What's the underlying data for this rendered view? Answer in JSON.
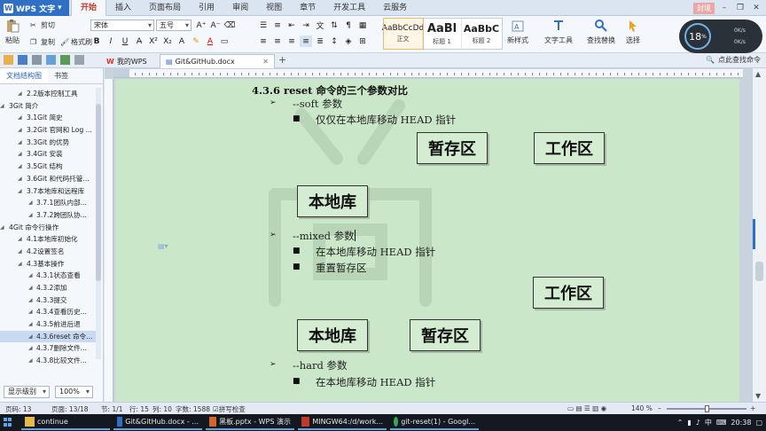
{
  "app": {
    "name": "WPS 文字",
    "ribbon_tabs": [
      "开始",
      "插入",
      "页面布局",
      "引用",
      "审阅",
      "视图",
      "章节",
      "开发工具",
      "云服务"
    ],
    "active_tab": "开始",
    "login": "封境"
  },
  "ribbon": {
    "paste": "粘贴",
    "cut": "剪切",
    "copy": "复制",
    "format_painter": "格式刷",
    "font": "宋体",
    "font_size": "五号",
    "styles": [
      {
        "sample": "AaBbCcDd",
        "label": "正文"
      },
      {
        "sample": "AaBl",
        "label": "标题 1"
      },
      {
        "sample": "AaBbC",
        "label": "标题 2"
      }
    ],
    "new_style": "新样式",
    "text_tools": "文字工具",
    "find_replace": "查找替换",
    "select": "选择"
  },
  "speed_widget": {
    "percent": "18",
    "unit": "%",
    "up": "0K/s",
    "down": "0K/s"
  },
  "quickbar": {
    "tabs": [
      {
        "label": "我的WPS"
      },
      {
        "label": "Git&GitHub.docx"
      }
    ],
    "help": "点此查找命令"
  },
  "nav": {
    "tabs": [
      "文档结构图",
      "书签"
    ],
    "items": [
      {
        "text": "2.2版本控制工具",
        "level": 2,
        "selected": false
      },
      {
        "text": "3Git 简介",
        "level": 1,
        "selected": false
      },
      {
        "text": "3.1Git 简史",
        "level": 2,
        "selected": false
      },
      {
        "text": "3.2Git 官网和 Log ...",
        "level": 2,
        "selected": false
      },
      {
        "text": "3.3Git 的优势",
        "level": 2,
        "selected": false
      },
      {
        "text": "3.4Git 安装",
        "level": 2,
        "selected": false
      },
      {
        "text": "3.5Git 结构",
        "level": 2,
        "selected": false
      },
      {
        "text": "3.6Git 和代码托管...",
        "level": 2,
        "selected": false
      },
      {
        "text": "3.7本地库和远程库",
        "level": 2,
        "selected": false
      },
      {
        "text": "3.7.1团队内部...",
        "level": 3,
        "selected": false
      },
      {
        "text": "3.7.2跨团队协...",
        "level": 3,
        "selected": false
      },
      {
        "text": "4Git 命令行操作",
        "level": 1,
        "selected": false
      },
      {
        "text": "4.1本地库初始化",
        "level": 2,
        "selected": false
      },
      {
        "text": "4.2设置签名",
        "level": 2,
        "selected": false
      },
      {
        "text": "4.3基本操作",
        "level": 2,
        "selected": false
      },
      {
        "text": "4.3.1状态查看",
        "level": 3,
        "selected": false
      },
      {
        "text": "4.3.2添加",
        "level": 3,
        "selected": false
      },
      {
        "text": "4.3.3提交",
        "level": 3,
        "selected": false
      },
      {
        "text": "4.3.4查看历史...",
        "level": 3,
        "selected": false
      },
      {
        "text": "4.3.5前进后退",
        "level": 3,
        "selected": false
      },
      {
        "text": "4.3.6reset 命令...",
        "level": 3,
        "selected": true
      },
      {
        "text": "4.3.7删除文件...",
        "level": 3,
        "selected": false
      },
      {
        "text": "4.3.8比较文件...",
        "level": 3,
        "selected": false
      }
    ],
    "footer_level": "显示级别",
    "footer_zoom": "100%"
  },
  "document": {
    "heading": "4.3.6   reset 命令的三个参数对比",
    "soft_label": "--soft 参数",
    "soft_point": "仅仅在本地库移动 HEAD 指针",
    "soft_boxes": [
      "暂存区",
      "工作区",
      "本地库"
    ],
    "mixed_label": "--mixed 参数",
    "mixed_points": [
      "在本地库移动 HEAD 指针",
      "重置暂存区"
    ],
    "mixed_boxes": [
      "工作区",
      "本地库",
      "暂存区"
    ],
    "hard_label": "--hard 参数",
    "hard_point": "在本地库移动 HEAD 指针"
  },
  "statusbar": {
    "page": "页码: 13",
    "pages": "页面: 13/18",
    "section": "节: 1/1",
    "row": "行: 15",
    "col": "列: 10",
    "words": "字数: 1588",
    "spell": "拼写检查",
    "zoom": "140 %"
  },
  "taskbar": {
    "items": [
      {
        "label": "continue"
      },
      {
        "label": "Git&GitHub.docx - ..."
      },
      {
        "label": "黑板.pptx - WPS 演示"
      },
      {
        "label": "MINGW64:/d/work..."
      },
      {
        "label": "git-reset(1) - Googl..."
      }
    ],
    "ime": "中",
    "time": "20:38"
  }
}
